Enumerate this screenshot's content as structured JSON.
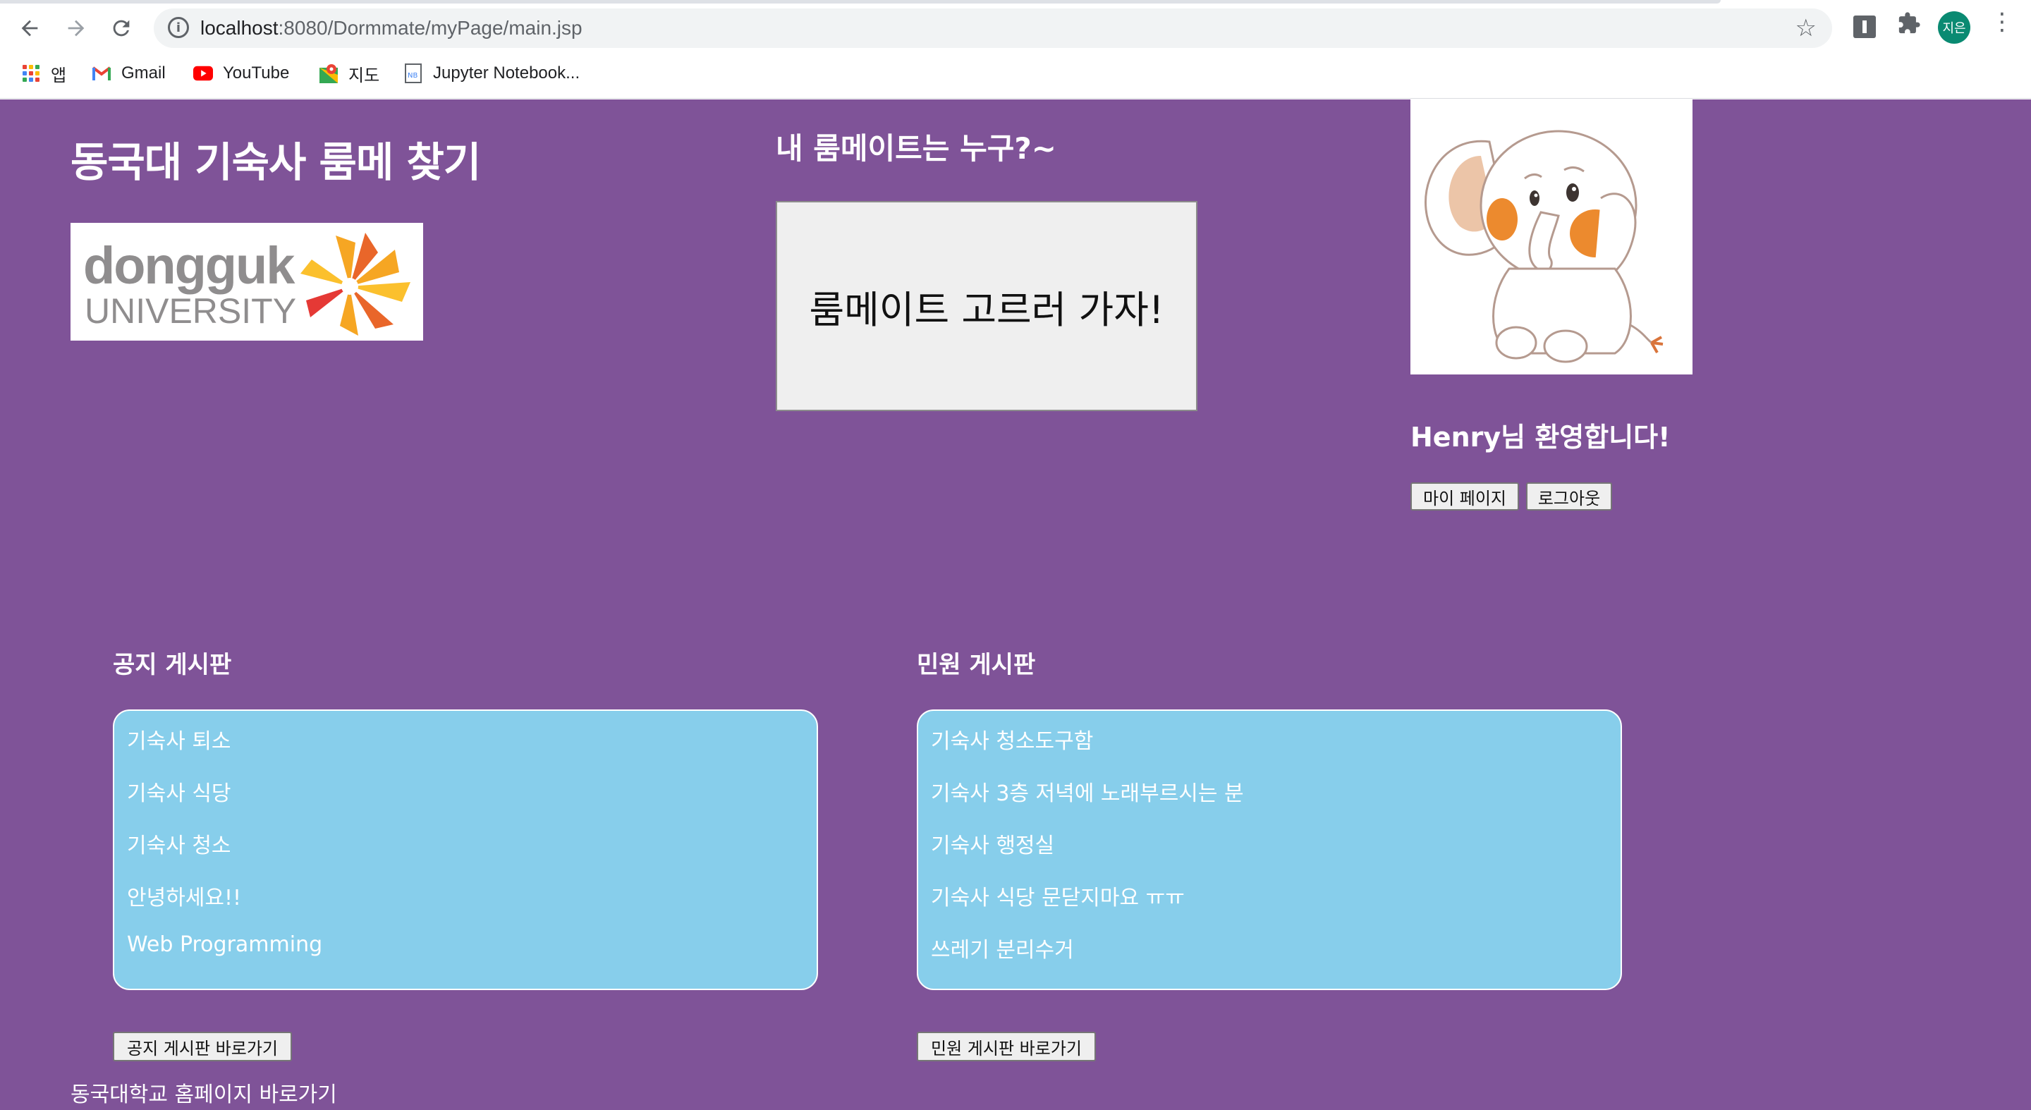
{
  "browser": {
    "url_host": "localhost",
    "url_rest": ":8080/Dormmate/myPage/main.jsp",
    "profile_initials": "지은",
    "bookmarks": [
      {
        "label": "앱",
        "icon": "apps-grid-icon"
      },
      {
        "label": "Gmail",
        "icon": "gmail-icon"
      },
      {
        "label": "YouTube",
        "icon": "youtube-icon"
      },
      {
        "label": "지도",
        "icon": "maps-icon"
      },
      {
        "label": "Jupyter Notebook...",
        "icon": "jupyter-icon"
      }
    ]
  },
  "header": {
    "site_title": "동국대 기숙사 룸메 찾기",
    "logo_word1": "dongguk",
    "logo_word2": "UNIVERSITY",
    "roommate_title": "내 룸메이트는 누구?~",
    "go_button": "룸메이트 고르러 가자!"
  },
  "user": {
    "name": "Henry",
    "welcome_suffix": "님 환영합니다!",
    "mypage_button": "마이 페이지",
    "logout_button": "로그아웃"
  },
  "notice_board": {
    "title": "공지 게시판",
    "items": [
      "기숙사 퇴소",
      "기숙사 식당",
      "기숙사 청소",
      "안녕하세요!!",
      "Web Programming"
    ],
    "button": "공지 게시판 바로가기"
  },
  "complaint_board": {
    "title": "민원 게시판",
    "items": [
      "기숙사 청소도구함",
      "기숙사 3층 저녁에 노래부르시는 분",
      "기숙사 행정실",
      "기숙사 식당 문닫지마요 ㅠㅠ",
      "쓰레기 분리수거"
    ],
    "button": "민원 게시판 바로가기"
  },
  "footer": {
    "homepage_link": "동국대학교 홈페이지 바로가기"
  },
  "colors": {
    "page_background": "#7f5398",
    "board_background": "#87ceeb",
    "button_background": "#efefef"
  }
}
